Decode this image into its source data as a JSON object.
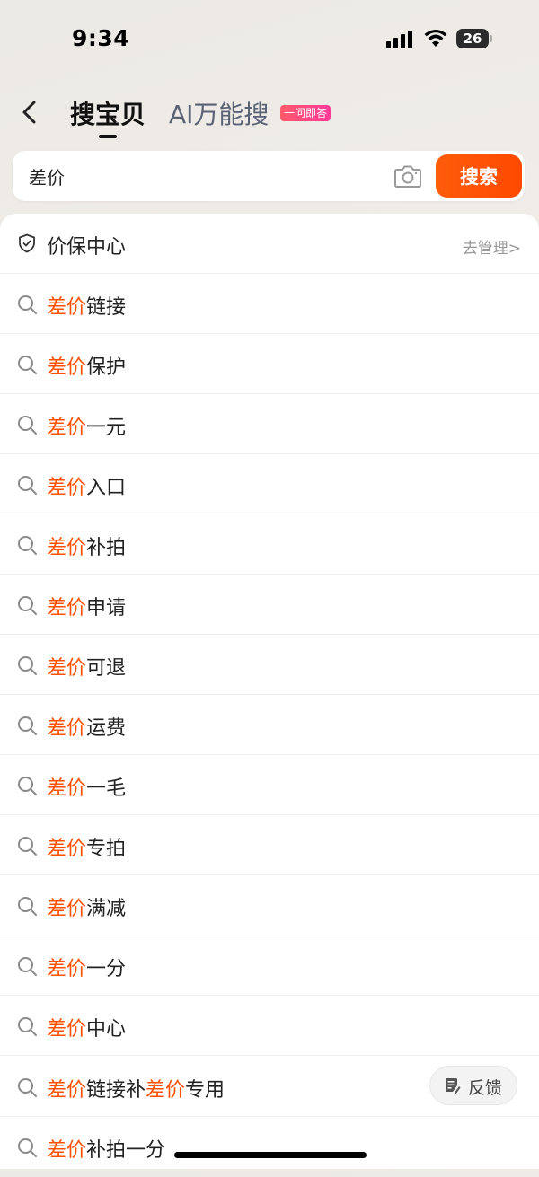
{
  "status_bar": {
    "time": "9:34",
    "battery": "26"
  },
  "header": {
    "tab_active": "搜宝贝",
    "tab_ai": "AI万能搜",
    "ai_badge": "一问即答"
  },
  "search": {
    "value": "差价",
    "button_label": "搜索",
    "camera_icon": "camera-icon"
  },
  "protection": {
    "label": "价保中心",
    "manage_link": "去管理>",
    "icon": "shield-icon"
  },
  "suggestions": [
    {
      "hl": "差价",
      "rest": "链接"
    },
    {
      "hl": "差价",
      "rest": "保护"
    },
    {
      "hl": "差价",
      "rest": "一元"
    },
    {
      "hl": "差价",
      "rest": "入口"
    },
    {
      "hl": "差价",
      "rest": "补拍"
    },
    {
      "hl": "差价",
      "rest": "申请"
    },
    {
      "hl": "差价",
      "rest": "可退"
    },
    {
      "hl": "差价",
      "rest": "运费"
    },
    {
      "hl": "差价",
      "rest": "一毛"
    },
    {
      "hl": "差价",
      "rest": "专拍"
    },
    {
      "hl": "差价",
      "rest": "满减"
    },
    {
      "hl": "差价",
      "rest": "一分"
    },
    {
      "hl": "差价",
      "rest": "中心"
    }
  ],
  "suggestion_special": {
    "hl1": "差价",
    "mid": "链接补",
    "hl2": "差价",
    "rest": "专用"
  },
  "suggestion_last": {
    "hl": "差价",
    "rest": "补拍一分"
  },
  "feedback": {
    "label": "反馈"
  },
  "colors": {
    "accent": "#ff5000",
    "highlight": "#ff5000"
  }
}
